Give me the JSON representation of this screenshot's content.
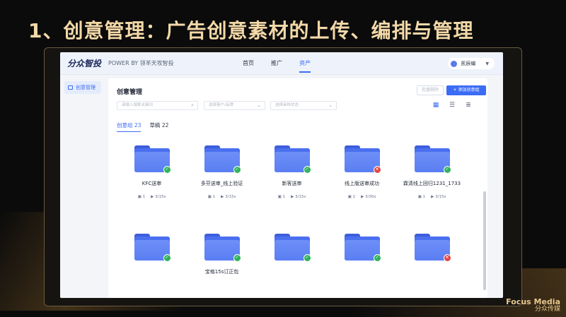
{
  "slide": {
    "title": "1、创意管理：广告创意素材的上传、编排与管理"
  },
  "topbar": {
    "logo": "分众智投",
    "powered_by": "POWER BY 领羊天攻智投",
    "nav": [
      {
        "label": "首页"
      },
      {
        "label": "推广"
      },
      {
        "label": "资产"
      }
    ],
    "active_nav": "资产",
    "user_name": "凯辰编"
  },
  "sidebar": {
    "items": [
      {
        "label": "创意管理"
      }
    ]
  },
  "main": {
    "page_title": "创意管理",
    "batch_delete_label": "批量删除",
    "add_group_label": "+ 添加创意组",
    "search_keyword_placeholder": "请输入搜索关键词",
    "filter_account_placeholder": "选择客户/品牌",
    "filter_status_placeholder": "选择审核状态",
    "tabs": [
      {
        "label": "创意组 23"
      },
      {
        "label": "草稿 22"
      }
    ],
    "cards": [
      {
        "name": "KFC送审",
        "images": "1",
        "videos": "3/15s",
        "status": "ok"
      },
      {
        "name": "多芬送审_线上验证",
        "images": "1",
        "videos": "3/15s",
        "status": "ok"
      },
      {
        "name": "新客送审",
        "images": "1",
        "videos": "3/15s",
        "status": "ok"
      },
      {
        "name": "线上版送审成功",
        "images": "2",
        "videos": "3/30s",
        "status": "err"
      },
      {
        "name": "霖清线上回归1231_1733",
        "images": "1",
        "videos": "3/15s",
        "status": "ok"
      },
      {
        "name": "",
        "images": "",
        "videos": "",
        "status": "ok"
      },
      {
        "name": "宝格15s订正包",
        "images": "",
        "videos": "",
        "status": "ok"
      },
      {
        "name": "",
        "images": "",
        "videos": "",
        "status": "ok"
      },
      {
        "name": "",
        "images": "",
        "videos": "",
        "status": "ok"
      },
      {
        "name": "",
        "images": "",
        "videos": "",
        "status": "err"
      }
    ]
  },
  "watermark": {
    "main": "Focus Media",
    "sub": "分众传媒"
  }
}
